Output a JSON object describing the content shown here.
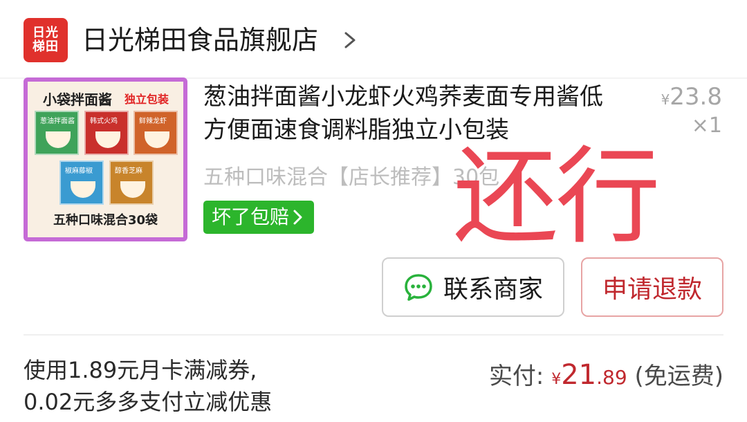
{
  "store": {
    "logo_line1": "日光",
    "logo_line2": "梯田",
    "name": "日光梯田食品旗舰店",
    "logo_color": "#e0312c"
  },
  "product": {
    "title": "葱油拌面酱小龙虾火鸡荞麦面专用酱低方便面速食调料脂独立小包装",
    "spec": "五种口味混合【店长推荐】30包",
    "price_symbol": "¥",
    "price": "23.8",
    "quantity": "×1",
    "guarantee_label": "坏了包赔",
    "image": {
      "title": "小袋拌面酱",
      "badge": "独立包装",
      "packs": [
        "葱油拌面酱",
        "韩式火鸡",
        "鲜辣龙虾",
        "椒麻藤椒",
        "醇香芝麻"
      ],
      "footer": "五种口味混合30袋"
    }
  },
  "stamp_text": "还行",
  "buttons": {
    "contact": "联系商家",
    "refund": "申请退款"
  },
  "promo": {
    "line1": "使用1.89元月卡满减券,",
    "line2": "0.02元多多支付立减优惠"
  },
  "payment": {
    "label": "实付:",
    "currency": "¥",
    "amount_int": "21",
    "amount_dec": ".89",
    "shipping": "(免运费)"
  },
  "colors": {
    "accent_red": "#c0282e",
    "guarantee_green": "#2cb52c",
    "stamp_red": "#ea4754"
  }
}
